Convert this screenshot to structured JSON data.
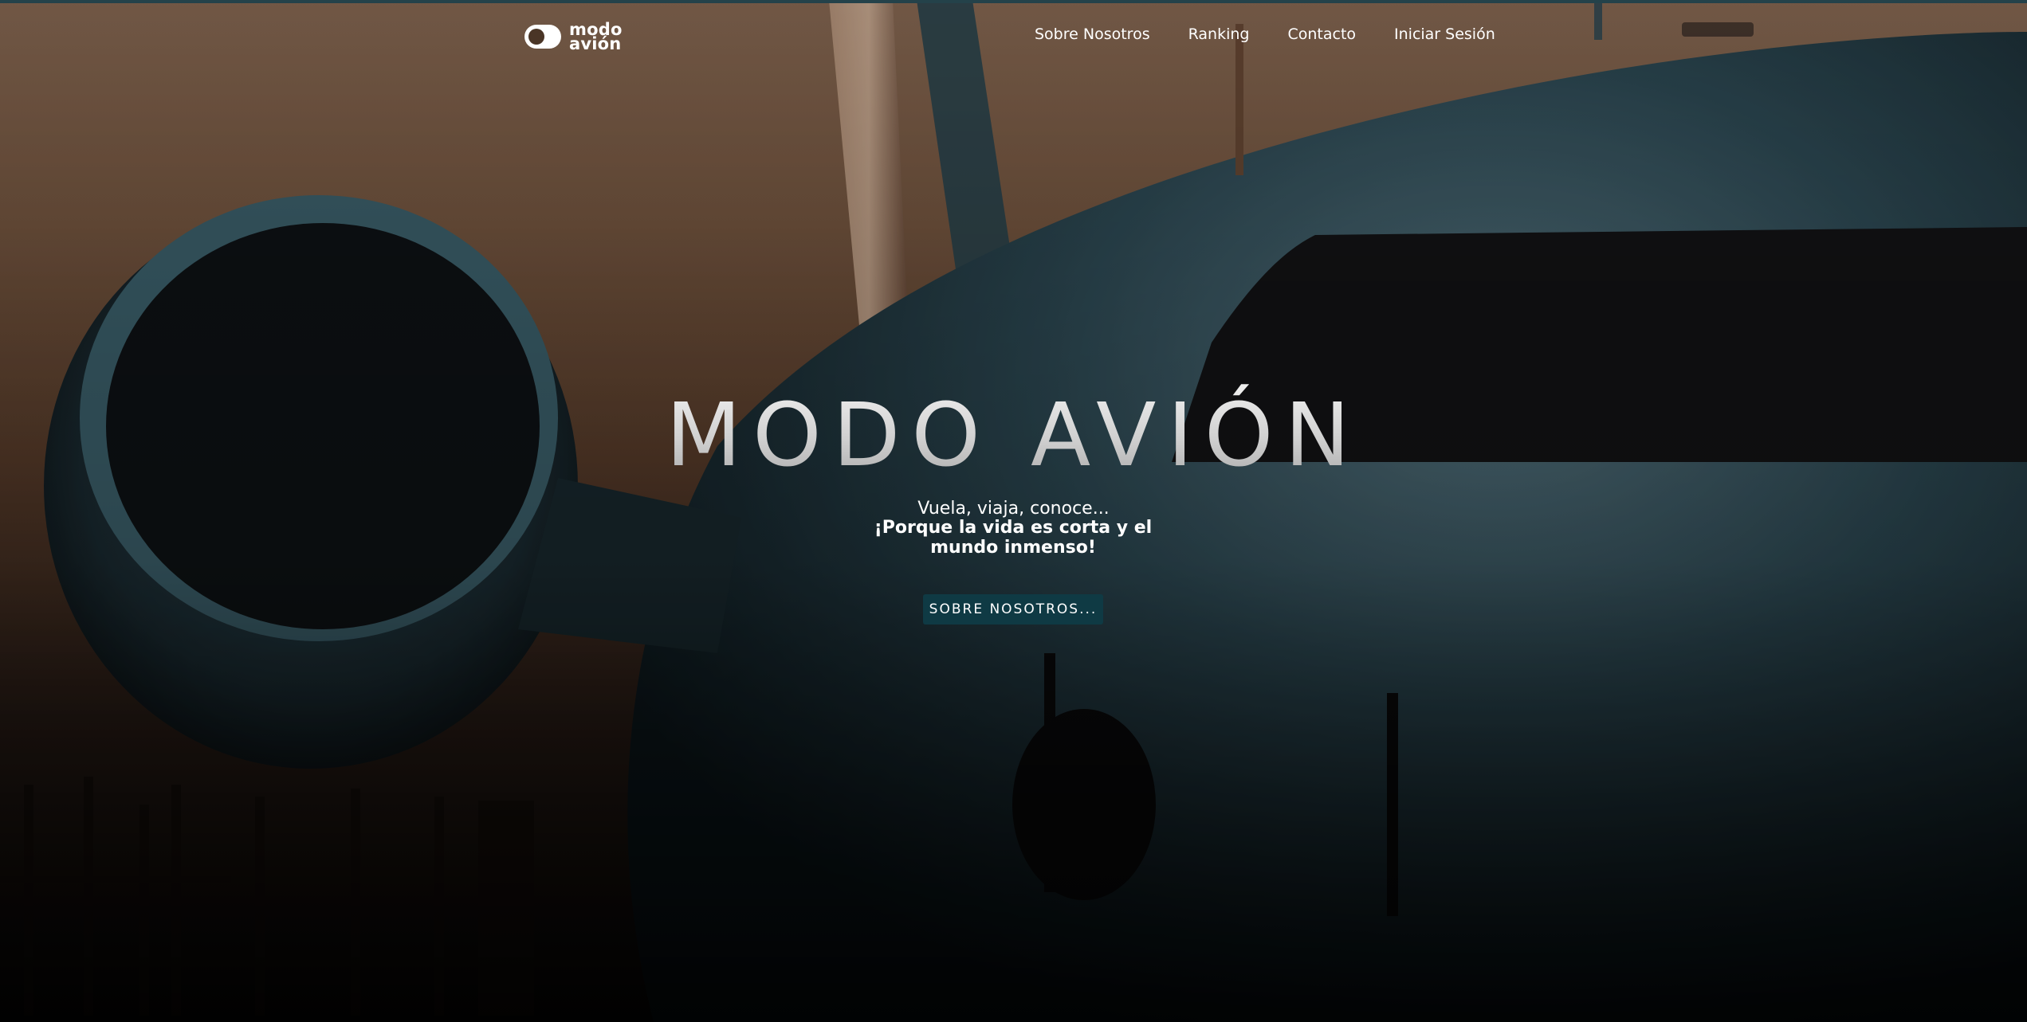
{
  "brand": {
    "logo_line1": "modo",
    "logo_line2": "avión"
  },
  "nav": {
    "items": [
      {
        "label": "Sobre Nosotros"
      },
      {
        "label": "Ranking"
      },
      {
        "label": "Contacto"
      },
      {
        "label": "Iniciar Sesión"
      }
    ]
  },
  "hero": {
    "title": "MODO AVIÓN",
    "tagline_1": "Vuela, viaja, conoce...",
    "tagline_2": "¡Porque la vida es corta y el mundo inmenso!",
    "cta_label": "SOBRE NOSOTROS..."
  },
  "colors": {
    "cta_background": "#0f3a44",
    "text": "#ffffff"
  }
}
